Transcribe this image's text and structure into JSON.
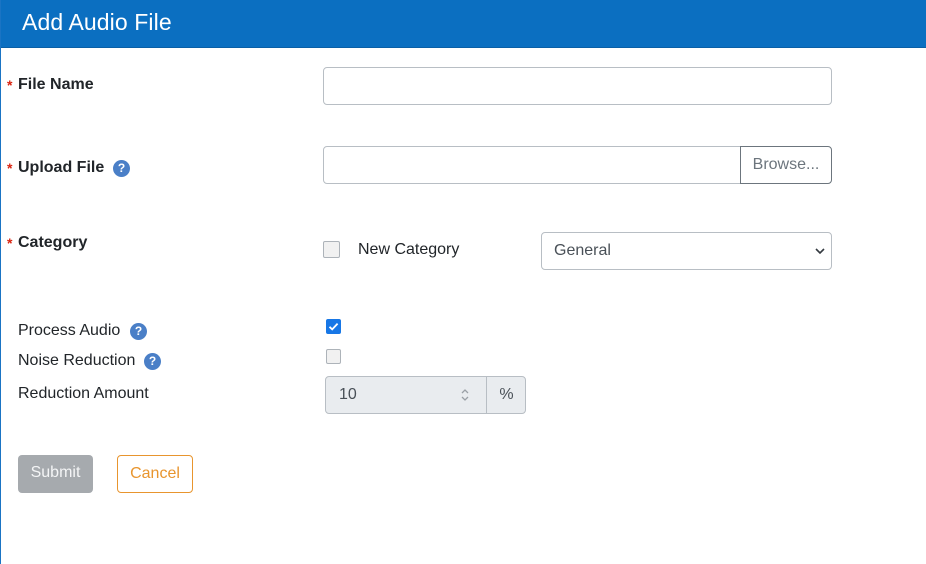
{
  "dialog": {
    "title": "Add Audio File"
  },
  "form": {
    "required_mark": "*",
    "file_name": {
      "label": "File Name",
      "value": ""
    },
    "upload_file": {
      "label": "Upload File",
      "value": "",
      "browse_label": "Browse...",
      "help": "?"
    },
    "category": {
      "label": "Category",
      "new_category_label": "New Category",
      "new_category_checked": false,
      "selected": "General"
    },
    "process_audio": {
      "label": "Process Audio",
      "checked": true,
      "help": "?"
    },
    "noise_reduction": {
      "label": "Noise Reduction",
      "checked": false,
      "help": "?"
    },
    "reduction_amount": {
      "label": "Reduction Amount",
      "value": "10",
      "unit": "%"
    }
  },
  "actions": {
    "submit_label": "Submit",
    "cancel_label": "Cancel"
  },
  "colors": {
    "header": "#0b6fc1",
    "required": "#d9230f",
    "help": "#4a7fc7",
    "checkbox_checked": "#1777e6",
    "cancel": "#e8952e",
    "submit_disabled": "#a6aaae"
  },
  "icons": {
    "help": "question-circle-icon",
    "select_caret": "chevron-down-icon",
    "checkmark": "check-icon",
    "spinner": "updown-arrows-icon"
  }
}
